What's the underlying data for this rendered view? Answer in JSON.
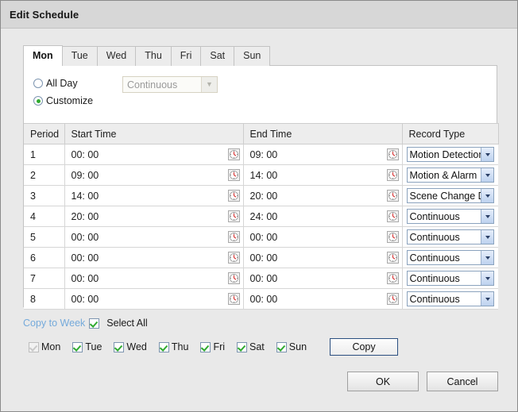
{
  "window": {
    "title": "Edit Schedule"
  },
  "tabs": [
    {
      "label": "Mon",
      "active": true
    },
    {
      "label": "Tue",
      "active": false
    },
    {
      "label": "Wed",
      "active": false
    },
    {
      "label": "Thu",
      "active": false
    },
    {
      "label": "Fri",
      "active": false
    },
    {
      "label": "Sat",
      "active": false
    },
    {
      "label": "Sun",
      "active": false
    }
  ],
  "mode": {
    "all_day_label": "All Day",
    "all_day_selected": false,
    "customize_label": "Customize",
    "customize_selected": true,
    "all_day_record_type": "Continuous",
    "all_day_select_disabled": true
  },
  "table": {
    "headers": [
      "Period",
      "Start Time",
      "End Time",
      "Record Type"
    ],
    "rows": [
      {
        "period": "1",
        "start": "00: 00",
        "end": "09: 00",
        "type": "Motion Detection"
      },
      {
        "period": "2",
        "start": "09: 00",
        "end": "14: 00",
        "type": "Motion & Alarm"
      },
      {
        "period": "3",
        "start": "14: 00",
        "end": "20: 00",
        "type": "Scene Change Detection"
      },
      {
        "period": "4",
        "start": "20: 00",
        "end": "24: 00",
        "type": "Continuous"
      },
      {
        "period": "5",
        "start": "00: 00",
        "end": "00: 00",
        "type": "Continuous"
      },
      {
        "period": "6",
        "start": "00: 00",
        "end": "00: 00",
        "type": "Continuous"
      },
      {
        "period": "7",
        "start": "00: 00",
        "end": "00: 00",
        "type": "Continuous"
      },
      {
        "period": "8",
        "start": "00: 00",
        "end": "00: 00",
        "type": "Continuous"
      }
    ]
  },
  "copy_to_week": {
    "label": "Copy to Week",
    "select_all_checked": true,
    "select_all_label": "Select All",
    "days": [
      {
        "label": "Mon",
        "checked": true,
        "disabled": true
      },
      {
        "label": "Tue",
        "checked": true,
        "disabled": false
      },
      {
        "label": "Wed",
        "checked": true,
        "disabled": false
      },
      {
        "label": "Thu",
        "checked": true,
        "disabled": false
      },
      {
        "label": "Fri",
        "checked": true,
        "disabled": false
      },
      {
        "label": "Sat",
        "checked": true,
        "disabled": false
      },
      {
        "label": "Sun",
        "checked": true,
        "disabled": false
      }
    ],
    "copy_button": "Copy"
  },
  "footer": {
    "ok_label": "OK",
    "cancel_label": "Cancel"
  },
  "icons": {
    "clock": "clock-icon",
    "chevron_down": "chevron-down-icon"
  },
  "colors": {
    "accent_blue": "#75aadb",
    "check_green": "#2faa2f",
    "titlebar": "#d7d7d7",
    "body": "#e9e9e9"
  }
}
